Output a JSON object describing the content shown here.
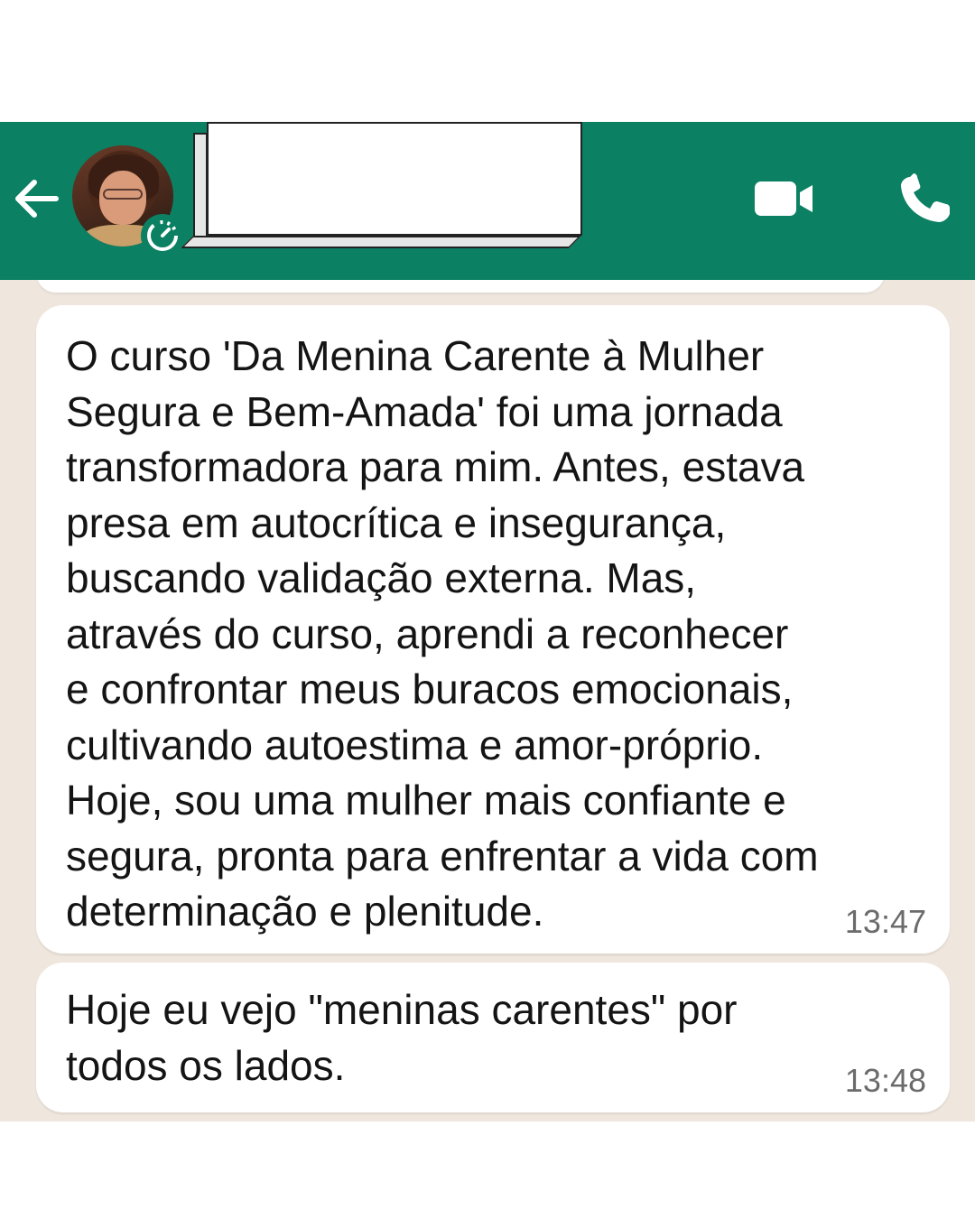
{
  "header": {
    "back_icon": "arrow-left-icon",
    "contact_name": "",
    "video_icon": "video-camera-icon",
    "call_icon": "phone-icon",
    "colors": {
      "header_bg": "#0b8063",
      "chat_bg": "#efe7de",
      "bubble_bg": "#ffffff"
    }
  },
  "messages": [
    {
      "text": "O curso 'Da Menina Carente à Mulher\nSegura e Bem-Amada' foi uma jornada\ntransformadora para mim. Antes, estava\npresa em autocrítica e insegurança,\nbuscando validação externa. Mas,\natravés do curso, aprendi a reconhecer\ne confrontar meus buracos emocionais,\ncultivando autoestima e amor-próprio.\nHoje, sou uma mulher mais confiante e\nsegura, pronta para enfrentar a vida com\ndeterminação e plenitude.",
      "time": "13:47"
    },
    {
      "text": "Hoje eu vejo \"meninas carentes\" por\ntodos os lados.",
      "time": "13:48"
    }
  ]
}
